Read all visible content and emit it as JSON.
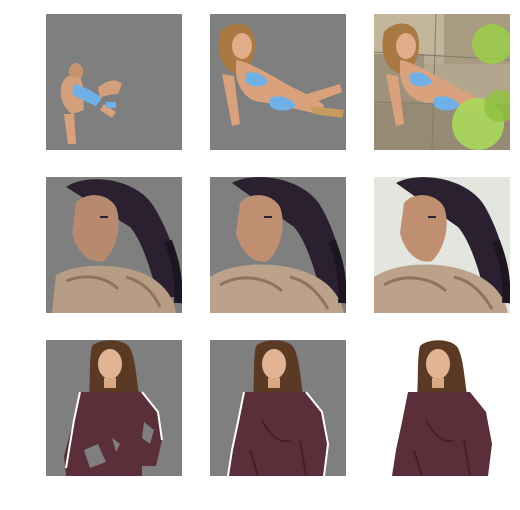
{
  "figure": {
    "rows": [
      {
        "subject": "woman-blue-bikini",
        "tiles": [
          {
            "variant": "partial-cutout",
            "background_color": "#7f7f7f"
          },
          {
            "variant": "refined-cutout",
            "background_color": "#7f7f7f"
          },
          {
            "variant": "original-photo",
            "background_color": "#b9ad98"
          }
        ]
      },
      {
        "subject": "woman-fur-coat",
        "tiles": [
          {
            "variant": "partial-cutout",
            "background_color": "#7f7f7f"
          },
          {
            "variant": "refined-cutout",
            "background_color": "#7f7f7f"
          },
          {
            "variant": "original-photo",
            "background_color": "#e2e6df"
          }
        ]
      },
      {
        "subject": "woman-maroon-top",
        "tiles": [
          {
            "variant": "partial-cutout",
            "background_color": "#7f7f7f"
          },
          {
            "variant": "refined-cutout",
            "background_color": "#7f7f7f"
          },
          {
            "variant": "original-photo",
            "background_color": "#ffffff"
          }
        ]
      }
    ],
    "colors": {
      "matte_gray": "#7f7f7f",
      "skin": "#d9a27c",
      "bikini": "#6fb1e6",
      "hair_blonde": "#a97944",
      "hair_dark": "#2b2030",
      "fur": "#b89d86",
      "maroon_top": "#5a2f3a",
      "hair_brown": "#5b3a25",
      "rock": "#a99a82",
      "foliage": "#9ccf4a"
    }
  }
}
